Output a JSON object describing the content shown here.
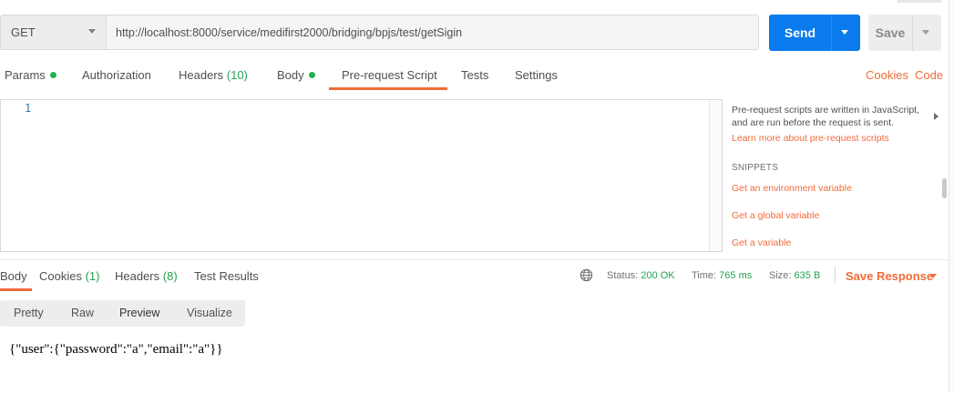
{
  "request": {
    "method": "GET",
    "url": "http://localhost:8000/service/medifirst2000/bridging/bpjs/test/getSigin",
    "send_label": "Send",
    "save_label": "Save"
  },
  "request_tabs": [
    {
      "label": "Params",
      "dot": true
    },
    {
      "label": "Authorization"
    },
    {
      "label": "Headers",
      "count": "(10)"
    },
    {
      "label": "Body",
      "dot": true
    },
    {
      "label": "Pre-request Script",
      "active": true
    },
    {
      "label": "Tests"
    },
    {
      "label": "Settings"
    }
  ],
  "request_links": {
    "cookies": "Cookies",
    "code": "Code"
  },
  "editor": {
    "line_number": "1"
  },
  "helper": {
    "description": "Pre-request scripts are written in JavaScript, and are run before the request is sent.",
    "learn_more": "Learn more about pre-request scripts",
    "snippets_heading": "SNIPPETS",
    "snippets": [
      "Get an environment variable",
      "Get a global variable",
      "Get a variable"
    ]
  },
  "response_tabs": [
    {
      "label": "Body",
      "active": true
    },
    {
      "label": "Cookies",
      "count": "(1)"
    },
    {
      "label": "Headers",
      "count": "(8)"
    },
    {
      "label": "Test Results"
    }
  ],
  "response_status": {
    "status_label": "Status:",
    "status_value": "200 OK",
    "time_label": "Time:",
    "time_value": "765 ms",
    "size_label": "Size:",
    "size_value": "635 B"
  },
  "save_response_label": "Save Response",
  "view_modes": [
    "Pretty",
    "Raw",
    "Preview",
    "Visualize"
  ],
  "active_view_mode": "Preview",
  "response_body": "{\"user\":{\"password\":\"a\",\"email\":\"a\"}}",
  "colors": {
    "accent": "#f26b3a",
    "primary": "#097bed",
    "success": "#26a250"
  },
  "icons": [
    "chevron-down-icon",
    "chevron-right-icon",
    "globe-icon",
    "status-dot-icon"
  ]
}
